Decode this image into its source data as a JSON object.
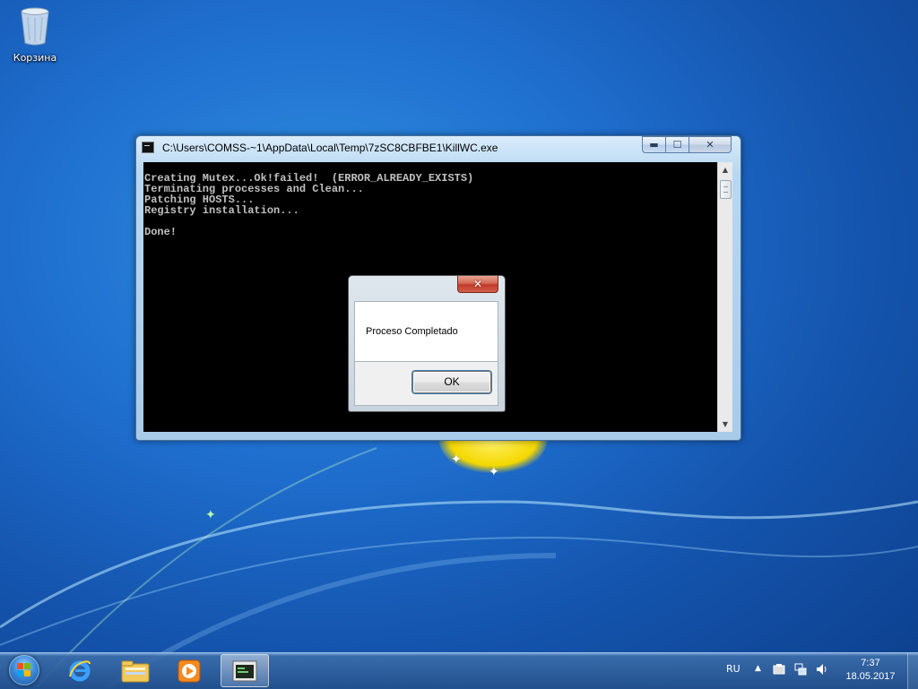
{
  "desktop": {
    "icons": [
      {
        "label": "Корзина",
        "icon": "recycle-bin-icon"
      }
    ]
  },
  "console_window": {
    "title": "C:\\Users\\COMSS-~1\\AppData\\Local\\Temp\\7zSC8CBFBE1\\KillWC.exe",
    "controls": {
      "minimize": "▬",
      "maximize": "☐",
      "close": "✕"
    },
    "output_lines": [
      "Creating Mutex...Ok!failed!  (ERROR_ALREADY_EXISTS)",
      "Terminating processes and Clean...",
      "Patching HOSTS...",
      "Registry installation...",
      "",
      "Done!"
    ]
  },
  "message_box": {
    "close_label": "✕",
    "message": "Proceso Completado",
    "ok_label": "OK"
  },
  "taskbar": {
    "start_icon": "windows-start-orb",
    "pinned": [
      {
        "name": "internet-explorer-icon",
        "active": false
      },
      {
        "name": "file-explorer-icon",
        "active": false
      },
      {
        "name": "media-player-icon",
        "active": false
      },
      {
        "name": "console-app-icon",
        "active": true
      }
    ],
    "tray": {
      "language": "RU",
      "show_hidden_icon": "▲",
      "icons": [
        "action-center-icon",
        "network-icon",
        "volume-icon"
      ]
    },
    "clock": {
      "time": "7:37",
      "date": "18.05.2017"
    }
  },
  "colors": {
    "desktop_blue": "#1f6fcf",
    "console_bg": "#000000",
    "console_text": "#c0c0c0",
    "close_red": "#c0392b"
  }
}
